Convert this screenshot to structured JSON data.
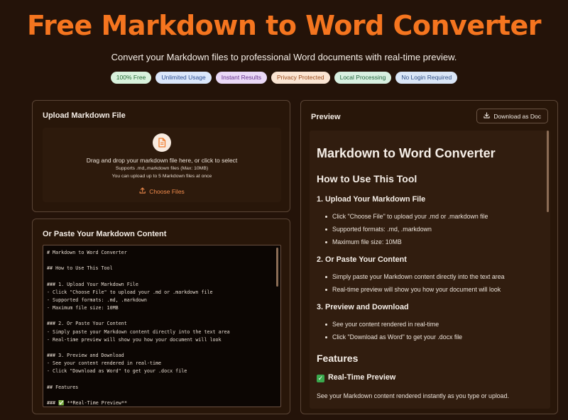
{
  "hero": {
    "title": "Free Markdown to Word Converter",
    "subtitle": "Convert your Markdown files to professional Word documents with real-time preview."
  },
  "badges": [
    {
      "label": "100% Free",
      "bg": "#d9f2dd",
      "fg": "#256b35"
    },
    {
      "label": "Unlimited Usage",
      "bg": "#dbe7fb",
      "fg": "#2d4f93"
    },
    {
      "label": "Instant Results",
      "bg": "#ead9f7",
      "fg": "#66308d"
    },
    {
      "label": "Privacy Protected",
      "bg": "#fbe5d3",
      "fg": "#9a4a1b"
    },
    {
      "label": "Local Processing",
      "bg": "#d8f0e1",
      "fg": "#22663d"
    },
    {
      "label": "No Login Required",
      "bg": "#dae6f7",
      "fg": "#2f4f86"
    }
  ],
  "upload": {
    "title": "Upload Markdown File",
    "icon": "file-icon",
    "main_text": "Drag and drop your markdown file here, or click to select",
    "formats_hint": "Supports .md,.markdown files (Max: 10MB)",
    "limit_hint": "You can upload up to 5 Markdown files at once",
    "choose_label": "Choose Files"
  },
  "paste": {
    "title": "Or Paste Your Markdown Content",
    "content": "# Markdown to Word Converter\n\n## How to Use This Tool\n\n### 1. Upload Your Markdown File\n- Click \"Choose File\" to upload your .md or .markdown file\n- Supported formats: .md, .markdown\n- Maximum file size: 10MB\n\n### 2. Or Paste Your Content\n- Simply paste your Markdown content directly into the text area\n- Real-time preview will show you how your document will look\n\n### 3. Preview and Download\n- See your content rendered in real-time\n- Click \"Download as Word\" to get your .docx file\n\n## Features\n\n### ✅ **Real-Time Preview**"
  },
  "preview": {
    "title": "Preview",
    "download_label": "Download as Doc",
    "h1": "Markdown to Word Converter",
    "h2_howto": "How to Use This Tool",
    "h3_upload": "1. Upload Your Markdown File",
    "upload_items": [
      "Click \"Choose File\" to upload your .md or .markdown file",
      "Supported formats: .md, .markdown",
      "Maximum file size: 10MB"
    ],
    "h3_paste": "2. Or Paste Your Content",
    "paste_items": [
      "Simply paste your Markdown content directly into the text area",
      "Real-time preview will show you how your document will look"
    ],
    "h3_download": "3. Preview and Download",
    "download_items": [
      "See your content rendered in real-time",
      "Click \"Download as Word\" to get your .docx file"
    ],
    "h2_features": "Features",
    "h3_realtime": "Real-Time Preview",
    "realtime_text": "See your Markdown content rendered instantly as you type or upload."
  },
  "colors": {
    "accent": "#f5751f",
    "background": "#241309"
  }
}
